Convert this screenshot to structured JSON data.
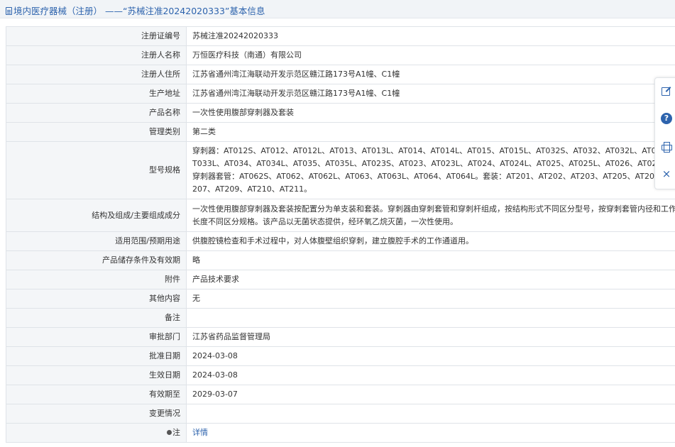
{
  "header": {
    "title": "境内医疗器械（注册） ——“苏械注准20242020333”基本信息"
  },
  "fields": [
    {
      "key": "注册证编号",
      "value": "苏械注准20242020333"
    },
    {
      "key": "注册人名称",
      "value": "万恒医疗科技（南通）有限公司"
    },
    {
      "key": "注册人住所",
      "value": "江苏省通州湾江海联动开发示范区赣江路173号A1幢、C1幢"
    },
    {
      "key": "生产地址",
      "value": "江苏省通州湾江海联动开发示范区赣江路173号A1幢、C1幢"
    },
    {
      "key": "产品名称",
      "value": "一次性使用腹部穿刺器及套装"
    },
    {
      "key": "管理类别",
      "value": "第二类"
    },
    {
      "key": "型号规格",
      "value": "穿刺器：AT012S、AT012、AT012L、AT013、AT013L、AT014、AT014L、AT015、AT015L、AT032S、AT032、AT032L、AT033、AT033L、AT034、AT034L、AT035、AT035L、AT023S、AT023、AT023L、AT024、AT024L、AT025、AT025L、AT026、AT026L。穿刺器套管：AT062S、AT062、AT062L、AT063、AT063L、AT064、AT064L。套装：AT201、AT202、AT203、AT205、AT206、AT207、AT209、AT210、AT211。"
    },
    {
      "key": "结构及组成/主要组成成分",
      "value": "一次性使用腹部穿刺器及套装按配置分为单支装和套装。穿刺器由穿刺套管和穿刺杆组成，按结构形式不同区分型号，按穿刺套管内径和工作长度不同区分规格。该产品以无菌状态提供，经环氧乙烷灭菌，一次性使用。"
    },
    {
      "key": "适用范围/预期用途",
      "value": "供腹腔镜检查和手术过程中，对人体腹壁组织穿刺，建立腹腔手术的工作通道用。"
    },
    {
      "key": "产品储存条件及有效期",
      "value": "略"
    },
    {
      "key": "附件",
      "value": "产品技术要求"
    },
    {
      "key": "其他内容",
      "value": "无"
    },
    {
      "key": "备注",
      "value": ""
    },
    {
      "key": "审批部门",
      "value": "江苏省药品监督管理局"
    },
    {
      "key": "批准日期",
      "value": "2024-03-08"
    },
    {
      "key": "生效日期",
      "value": "2024-03-08"
    },
    {
      "key": "有效期至",
      "value": "2029-03-07"
    },
    {
      "key": "变更情况",
      "value": ""
    },
    {
      "key": "注",
      "value": "详情"
    }
  ],
  "sidebar": {
    "icons": [
      "edit-icon",
      "help-icon",
      "print-icon",
      "close-icon"
    ],
    "help_glyph": "?",
    "close_glyph": "×"
  },
  "colors": {
    "accent": "#2d63ad",
    "key_bg": "#f4f6f8",
    "border": "#dfe3e8"
  }
}
